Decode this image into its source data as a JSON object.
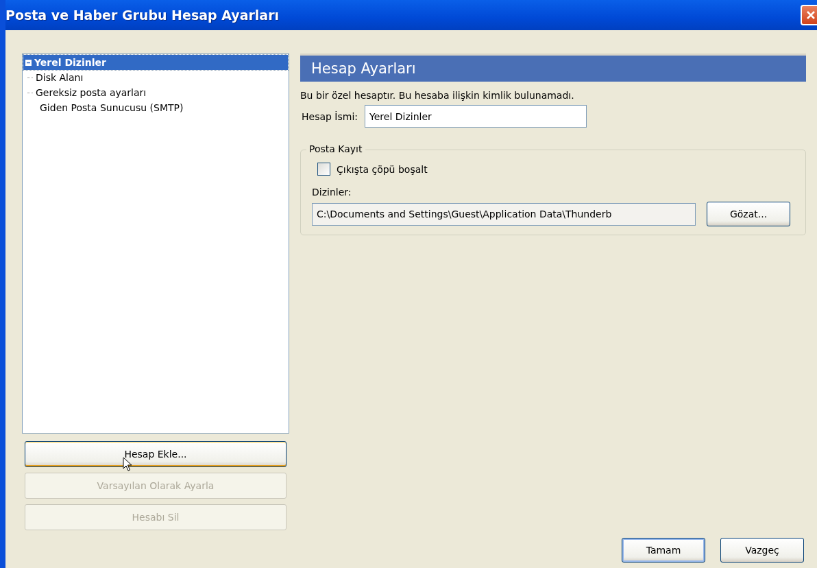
{
  "window": {
    "title": "Posta ve Haber Grubu Hesap Ayarları"
  },
  "tree": [
    {
      "label": "Yerel Dizinler",
      "selected": true,
      "expanded": true,
      "children": [
        {
          "label": "Disk Alanı",
          "selected": false
        },
        {
          "label": "Gereksiz posta ayarları",
          "selected": false
        }
      ]
    },
    {
      "label": "Giden Posta Sunucusu (SMTP)",
      "selected": false
    }
  ],
  "account_buttons": [
    {
      "label": "Hesap Ekle...",
      "disabled": false,
      "hovered": true
    },
    {
      "label": "Varsayılan Olarak Ayarla",
      "disabled": true,
      "hovered": false
    },
    {
      "label": "Hesabı Sil",
      "disabled": true,
      "hovered": false
    }
  ],
  "panel": {
    "title": "Hesap Ayarları",
    "notice": "Bu bir özel hesaptır. Bu hesaba ilişkin kimlik bulunamadı.",
    "name_label": "Hesap İsmi:",
    "name_value": "Yerel Dizinler",
    "group": {
      "title": "Posta Kayıt",
      "checkbox": {
        "label": "Çıkışta çöpü boşalt",
        "checked": false
      },
      "folder_label": "Dizinler:",
      "folder_value": "C:\\Documents and Settings\\Guest\\Application Data\\Thunderb",
      "browse": "Gözat..."
    }
  },
  "dialog_buttons": [
    {
      "label": "Tamam",
      "default": true
    },
    {
      "label": "Vazgeç",
      "default": false
    }
  ]
}
